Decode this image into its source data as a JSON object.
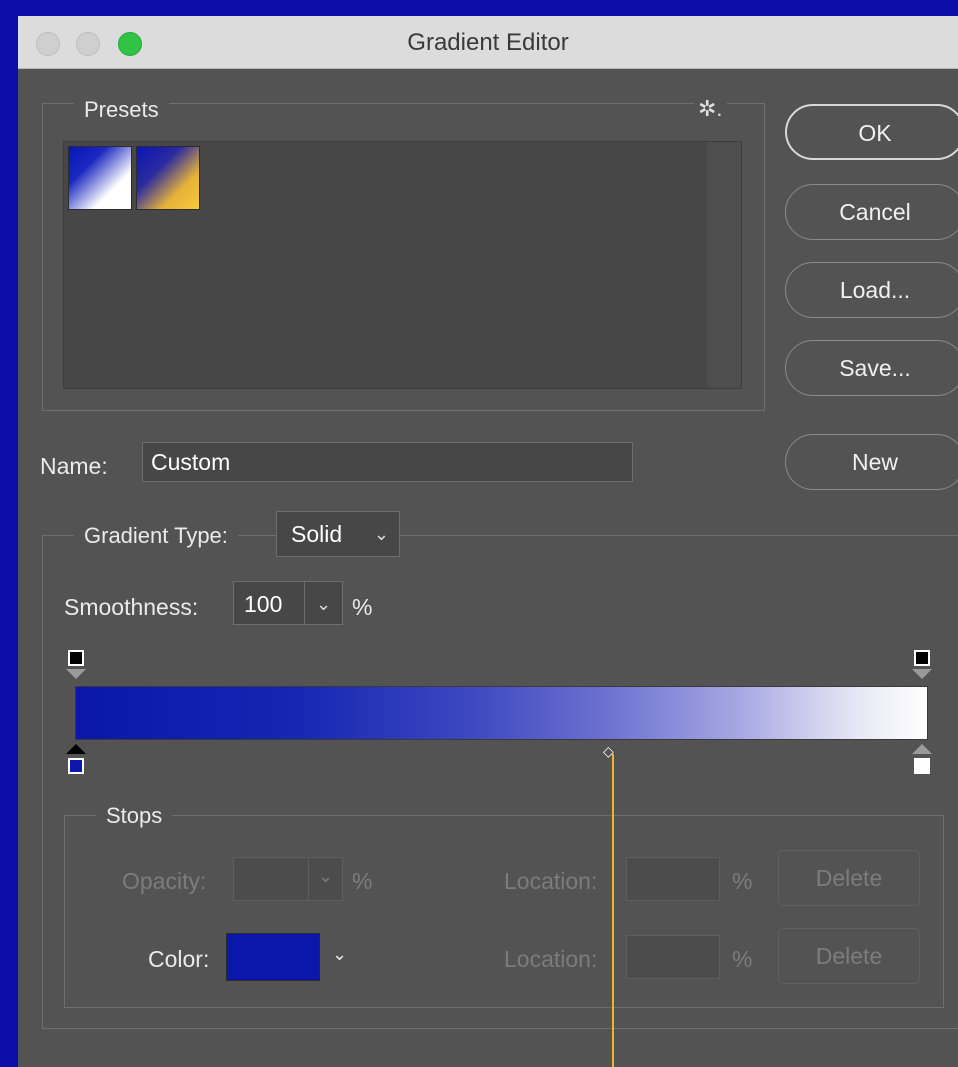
{
  "window": {
    "title": "Gradient Editor"
  },
  "presets": {
    "legend": "Presets",
    "gear_glyph": "✲.",
    "swatches": [
      {
        "name": "blue-to-white"
      },
      {
        "name": "blue-to-yellow"
      }
    ]
  },
  "buttons": {
    "ok": "OK",
    "cancel": "Cancel",
    "load": "Load...",
    "save": "Save...",
    "new": "New"
  },
  "name_field": {
    "label": "Name:",
    "value": "Custom"
  },
  "gradient": {
    "type_label": "Gradient Type:",
    "type_value": "Solid",
    "smoothness_label": "Smoothness:",
    "smoothness_value": "100",
    "smoothness_unit": "%",
    "colors": {
      "start": "#0a17aa",
      "end": "#ffffff",
      "guide": "#f2b233"
    }
  },
  "stops": {
    "legend": "Stops",
    "opacity_label": "Opacity:",
    "opacity_value": "",
    "opacity_unit": "%",
    "location_label_1": "Location:",
    "location_value_1": "",
    "location_unit_1": "%",
    "delete_1": "Delete",
    "color_label": "Color:",
    "color_value": "#0a17aa",
    "location_label_2": "Location:",
    "location_value_2": "",
    "location_unit_2": "%",
    "delete_2": "Delete"
  },
  "icons": {
    "chevron": "⌄",
    "midpoint": "◇"
  }
}
